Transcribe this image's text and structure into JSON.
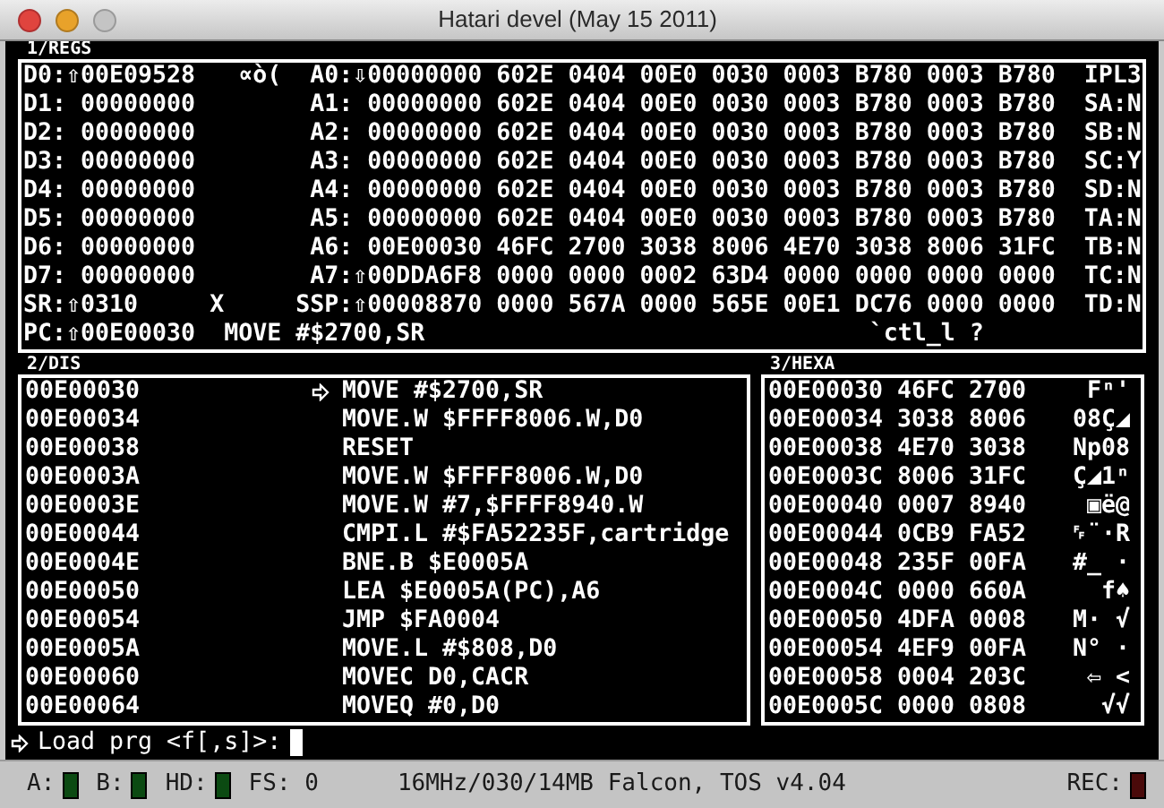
{
  "window": {
    "title": "Hatari devel (May 15 2011)"
  },
  "regs": {
    "label": "1/REGS",
    "lines": [
      "D0:⇧00E09528   ∝ò(  A0:⇩00000000 602E 0404 00E0 0030 0003 B780 0003 B780  IPL3",
      "D1: 00000000        A1: 00000000 602E 0404 00E0 0030 0003 B780 0003 B780  SA:N",
      "D2: 00000000        A2: 00000000 602E 0404 00E0 0030 0003 B780 0003 B780  SB:N",
      "D3: 00000000        A3: 00000000 602E 0404 00E0 0030 0003 B780 0003 B780  SC:Y",
      "D4: 00000000        A4: 00000000 602E 0404 00E0 0030 0003 B780 0003 B780  SD:N",
      "D5: 00000000        A5: 00000000 602E 0404 00E0 0030 0003 B780 0003 B780  TA:N",
      "D6: 00000000        A6: 00E00030 46FC 2700 3038 8006 4E70 3038 8006 31FC  TB:N",
      "D7: 00000000        A7:⇧00DDA6F8 0000 0000 0002 63D4 0000 0000 0000 0000  TC:N",
      "SR:⇧0310     X     SSP:⇧00008870 0000 567A 0000 565E 00E1 DC76 0000 0000  TD:N",
      "PC:⇧00E00030  MOVE #$2700,SR                               `ctl_l ?"
    ]
  },
  "dis": {
    "label": "2/DIS",
    "rows": [
      {
        "address": "00E00030",
        "selected": true,
        "instruction": "MOVE #$2700,SR"
      },
      {
        "address": "00E00034",
        "selected": false,
        "instruction": "MOVE.W $FFFF8006.W,D0"
      },
      {
        "address": "00E00038",
        "selected": false,
        "instruction": "RESET"
      },
      {
        "address": "00E0003A",
        "selected": false,
        "instruction": "MOVE.W $FFFF8006.W,D0"
      },
      {
        "address": "00E0003E",
        "selected": false,
        "instruction": "MOVE.W #7,$FFFF8940.W"
      },
      {
        "address": "00E00044",
        "selected": false,
        "instruction": "CMPI.L #$FA52235F,cartridge"
      },
      {
        "address": "00E0004E",
        "selected": false,
        "instruction": "BNE.B $E0005A"
      },
      {
        "address": "00E00050",
        "selected": false,
        "instruction": "LEA $E0005A(PC),A6"
      },
      {
        "address": "00E00054",
        "selected": false,
        "instruction": "JMP $FA0004"
      },
      {
        "address": "00E0005A",
        "selected": false,
        "instruction": "MOVE.L #$808,D0"
      },
      {
        "address": "00E00060",
        "selected": false,
        "instruction": "MOVEC D0,CACR"
      },
      {
        "address": "00E00064",
        "selected": false,
        "instruction": "MOVEQ #0,D0"
      }
    ]
  },
  "hexa": {
    "label": "3/HEXA",
    "rows": [
      {
        "address": "00E00030",
        "words": [
          "46FC",
          "2700"
        ],
        "ascii": "Fⁿ'"
      },
      {
        "address": "00E00034",
        "words": [
          "3038",
          "8006"
        ],
        "ascii": "08Ç◢"
      },
      {
        "address": "00E00038",
        "words": [
          "4E70",
          "3038"
        ],
        "ascii": "Np08"
      },
      {
        "address": "00E0003C",
        "words": [
          "8006",
          "31FC"
        ],
        "ascii": "Ç◢1ⁿ"
      },
      {
        "address": "00E00040",
        "words": [
          "0007",
          "8940"
        ],
        "ascii": "▣ë@"
      },
      {
        "address": "00E00044",
        "words": [
          "0CB9",
          "FA52"
        ],
        "ascii": "␌¨·R"
      },
      {
        "address": "00E00048",
        "words": [
          "235F",
          "00FA"
        ],
        "ascii": "#_ ·"
      },
      {
        "address": "00E0004C",
        "words": [
          "0000",
          "660A"
        ],
        "ascii": "f♠"
      },
      {
        "address": "00E00050",
        "words": [
          "4DFA",
          "0008"
        ],
        "ascii": "M· √"
      },
      {
        "address": "00E00054",
        "words": [
          "4EF9",
          "00FA"
        ],
        "ascii": "N° ·"
      },
      {
        "address": "00E00058",
        "words": [
          "0004",
          "203C"
        ],
        "ascii": "⇦ <"
      },
      {
        "address": "00E0005C",
        "words": [
          "0000",
          "0808"
        ],
        "ascii": "√√"
      }
    ]
  },
  "prompt": {
    "text": "Load prg <f[,s]>:"
  },
  "status_bar": {
    "drives": [
      {
        "label": "A:",
        "on": false
      },
      {
        "label": "B:",
        "on": false
      },
      {
        "label": "HD:",
        "on": false
      }
    ],
    "fs": "FS: 0",
    "machine": "16MHz/030/14MB Falcon, TOS v4.04",
    "rec": {
      "label": "REC:",
      "on": false
    }
  }
}
